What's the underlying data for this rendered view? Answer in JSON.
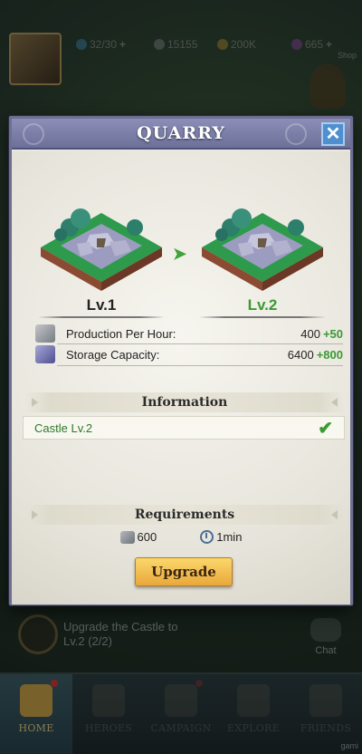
{
  "hud": {
    "troops": "32/30",
    "stone": "15155",
    "gold": "200K",
    "gems": "665",
    "shop_label": "Shop"
  },
  "quest": {
    "text_line1": "Upgrade the Castle to",
    "text_line2": "Lv.2 (2/2)"
  },
  "chat_label": "Chat",
  "nav": {
    "items": [
      {
        "label": "HOME"
      },
      {
        "label": "HEROES"
      },
      {
        "label": "CAMPAIGN"
      },
      {
        "label": "EXPLORE"
      },
      {
        "label": "FRIENDS"
      }
    ]
  },
  "watermark": "gami",
  "modal": {
    "title": "QUARRY",
    "close_icon": "close-icon",
    "current_level": "Lv.1",
    "next_level": "Lv.2",
    "stats": [
      {
        "name": "Production Per Hour:",
        "value": "400",
        "increase": "+50"
      },
      {
        "name": "Storage Capacity:",
        "value": "6400",
        "increase": "+800"
      }
    ],
    "information_title": "Information",
    "requirement_item": "Castle Lv.2",
    "requirements_title": "Requirements",
    "cost_stone": "600",
    "cost_time": "1min",
    "upgrade_label": "Upgrade"
  },
  "colors": {
    "accent_green": "#3a9a33",
    "header_purple": "#6d7098",
    "button_gold": "#e9a83a",
    "close_blue": "#4e8fd0"
  }
}
